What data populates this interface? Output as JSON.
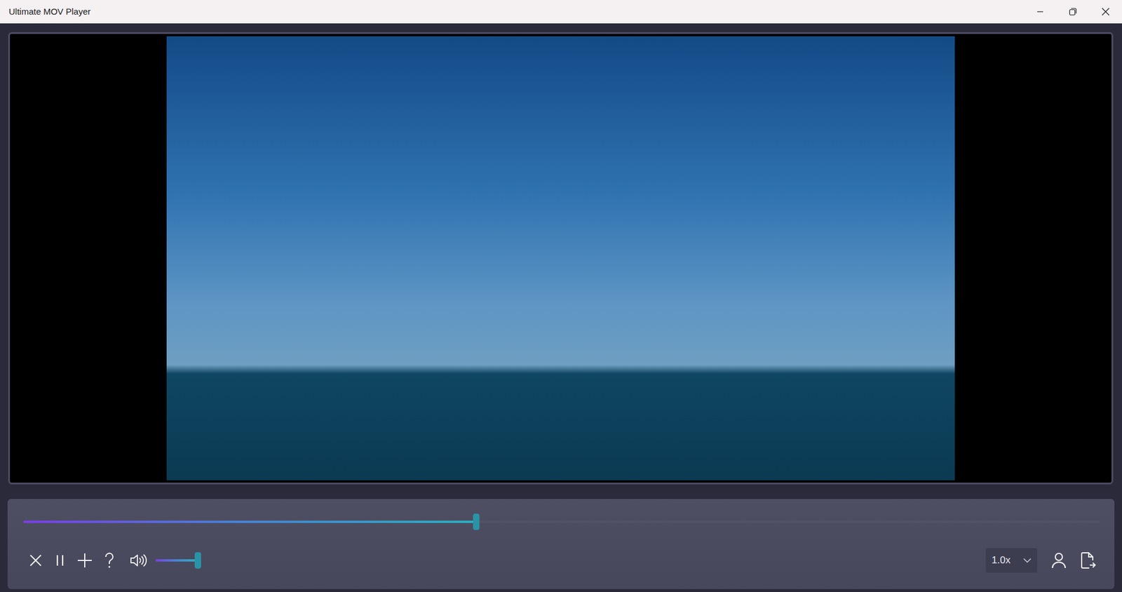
{
  "window": {
    "title": "Ultimate MOV Player"
  },
  "player": {
    "progress": {
      "level": 0.42
    },
    "playing": true,
    "muted": false,
    "volume": {
      "level": 1.0
    },
    "speed": "1.0x"
  }
}
